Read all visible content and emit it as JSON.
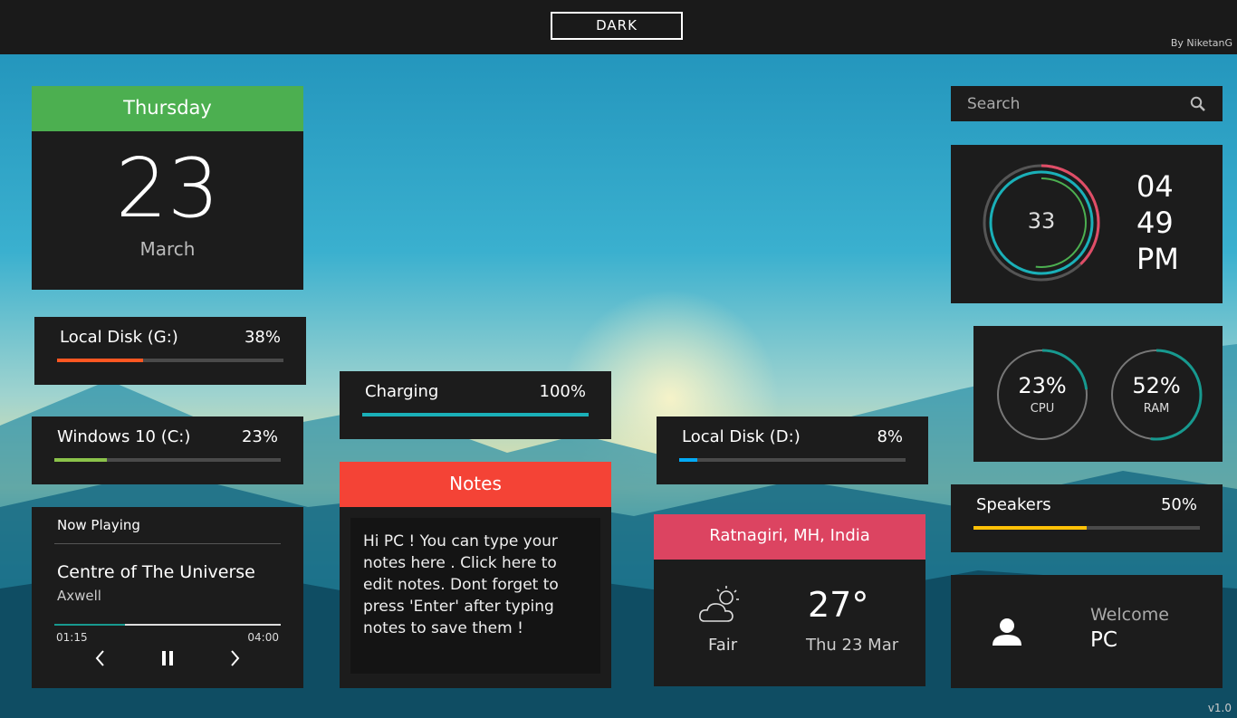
{
  "app": {
    "theme_button": "DARK",
    "byline": "By NiketanG",
    "version": "v1.0"
  },
  "date": {
    "weekday": "Thursday",
    "day": "23",
    "month": "March",
    "accent": "#4caf50"
  },
  "drives": {
    "g": {
      "label": "Local Disk (G:)",
      "value_text": "38%",
      "percent": 38,
      "color": "#ff5722"
    },
    "c": {
      "label": "Windows 10 (C:)",
      "value_text": "23%",
      "percent": 23,
      "color": "#8bc34a"
    },
    "d": {
      "label": "Local Disk (D:)",
      "value_text": "8%",
      "percent": 8,
      "color": "#03a9f4"
    }
  },
  "battery": {
    "label": "Charging",
    "value_text": "100%",
    "percent": 100,
    "color": "#1ab0b8"
  },
  "speakers": {
    "label": "Speakers",
    "value_text": "50%",
    "percent": 50,
    "color": "#ffc107"
  },
  "now_playing": {
    "heading": "Now Playing",
    "song": "Centre of The Universe",
    "artist": "Axwell",
    "elapsed": "01:15",
    "duration": "04:00",
    "progress": 0.3125,
    "icons": {
      "prev": "chevron-left-icon",
      "pause": "pause-icon",
      "next": "chevron-right-icon"
    }
  },
  "notes": {
    "heading": "Notes",
    "text": "Hi PC !  You can type your notes here .  Click here to edit notes. Dont forget to press 'Enter' after typing notes to save them !"
  },
  "weather": {
    "location": "Ratnagiri, MH, India",
    "temperature": "27°",
    "condition": "Fair",
    "date": "Thu 23 Mar",
    "icon": "partly-cloudy-icon"
  },
  "search": {
    "placeholder": "Search",
    "icon": "search-icon"
  },
  "clock": {
    "seconds": "33",
    "hour": "04",
    "minute": "49",
    "period": "PM"
  },
  "system": {
    "cpu": {
      "value_text": "23%",
      "label": "CPU",
      "percent": 23
    },
    "ram": {
      "value_text": "52%",
      "label": "RAM",
      "percent": 52
    }
  },
  "user": {
    "greeting": "Welcome",
    "name": "PC",
    "icon": "user-icon"
  },
  "colors": {
    "card": "#1c1c1c",
    "topbar": "#1a1a1a",
    "teal": "#17998f"
  }
}
